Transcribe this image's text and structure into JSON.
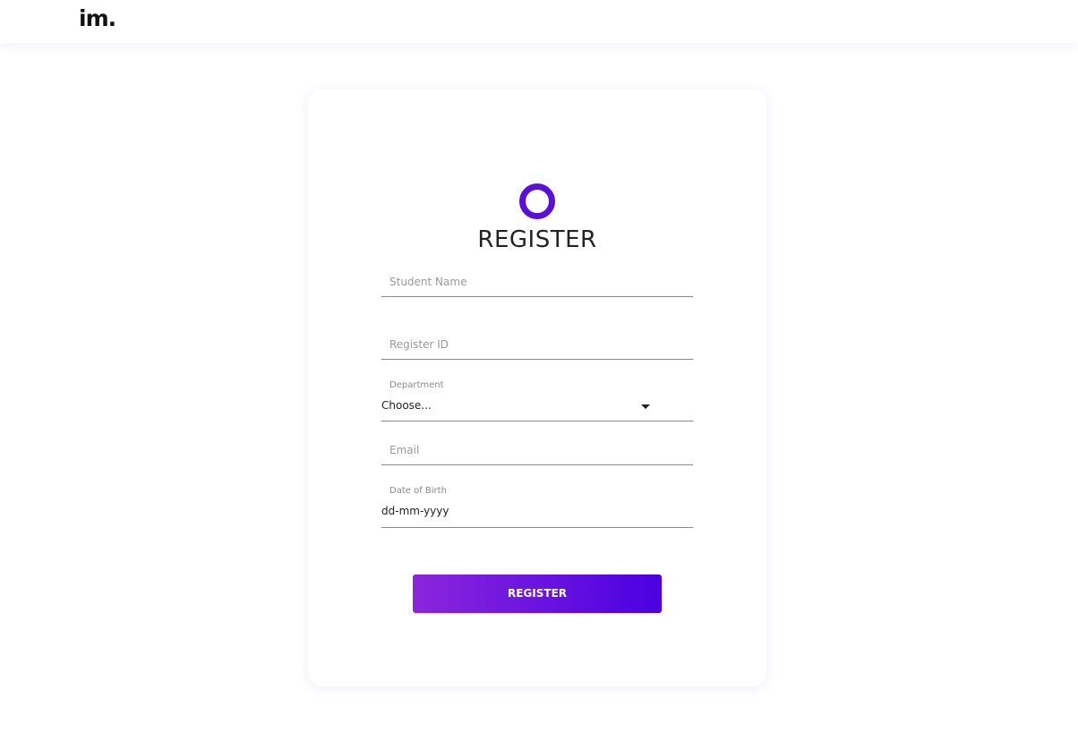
{
  "brand": {
    "logo_text": "im.",
    "accent_color": "#5a10d8"
  },
  "form": {
    "icon": "ring-icon",
    "title": "REGISTER",
    "fields": {
      "student_name": {
        "placeholder": "Student Name"
      },
      "register_id": {
        "placeholder": "Register ID"
      },
      "department": {
        "label": "Department",
        "selected": "Choose..."
      },
      "email": {
        "placeholder": "Email"
      },
      "date_of_birth": {
        "label": "Date of Birth",
        "value": "dd-mm-yyyy"
      }
    },
    "submit_label": "REGISTER",
    "submit_gradient": [
      "#8a26db",
      "#4a00e0"
    ]
  }
}
